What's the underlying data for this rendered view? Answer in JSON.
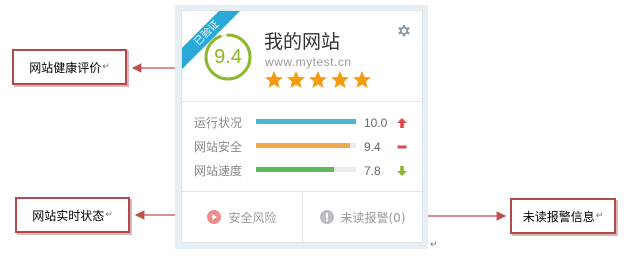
{
  "card": {
    "ribbon": "已验证",
    "score": "9.4",
    "site_name": "我的网站",
    "site_url": "www.mytest.cn",
    "stars": 5,
    "metrics": [
      {
        "label": "运行状况",
        "value": "10.0",
        "fraction": 1.0,
        "color": "#4ab6d6",
        "indicator": "up-arrow-icon",
        "indicator_color": "#e04a4a"
      },
      {
        "label": "网站安全",
        "value": "9.4",
        "fraction": 0.94,
        "color": "#f0a84a",
        "indicator": "minus-icon",
        "indicator_color": "#e04a4a"
      },
      {
        "label": "网站速度",
        "value": "7.8",
        "fraction": 0.78,
        "color": "#5bb85b",
        "indicator": "down-arrow-icon",
        "indicator_color": "#8ab82a"
      }
    ],
    "security_risk": "安全风险",
    "unread_alerts": "未读报警(0)"
  },
  "callouts": {
    "health": "网站健康评价",
    "realtime": "网站实时状态",
    "unread": "未读报警信息"
  },
  "paragraph_mark": "↵",
  "colors": {
    "accent_green": "#8ab82a",
    "ribbon_blue": "#2aa9d8",
    "star_orange": "#f39c12",
    "callout_border": "#b5484b",
    "arrow_red": "#c0504d"
  }
}
